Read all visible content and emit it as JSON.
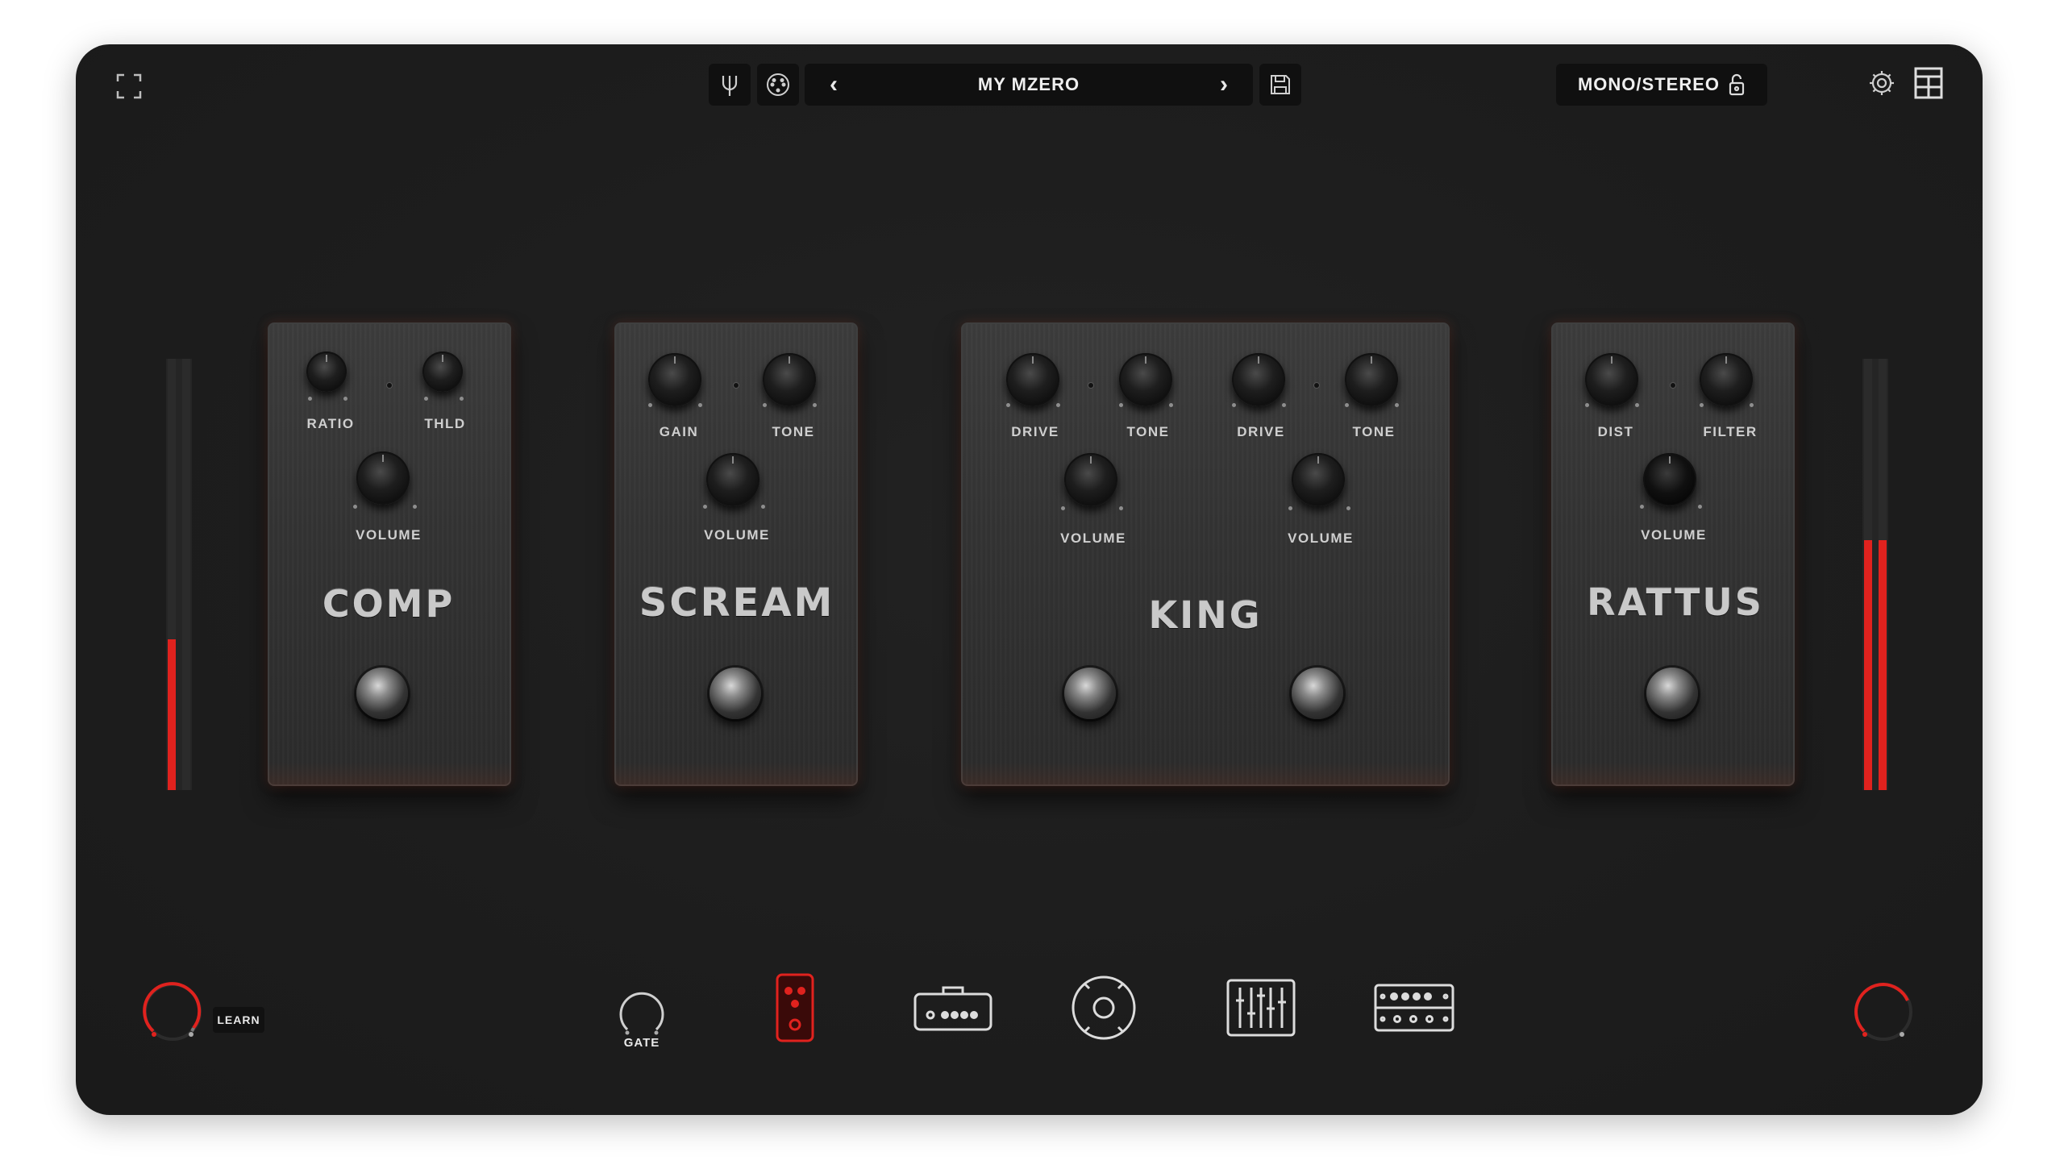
{
  "topbar": {
    "fullscreen_icon": "expand-corners-icon",
    "tuner_icon": "tuner-fork-icon",
    "midi_icon": "midi-port-icon",
    "preset_prev": "‹",
    "preset_name": "MY MZERO",
    "preset_next": "›",
    "save_icon": "floppy-disk-icon",
    "mode_label": "MONO/STEREO",
    "lock_icon": "padlock-icon",
    "settings_icon": "gear-icon",
    "logo_icon": "brand-logo-icon"
  },
  "meters": {
    "input_level": 0.35,
    "output_level": 0.58,
    "color": "#e0221e"
  },
  "pedals": [
    {
      "name": "COMP",
      "knobs": [
        "RATIO",
        "THLD",
        "VOLUME"
      ]
    },
    {
      "name": "SCREAM",
      "knobs": [
        "GAIN",
        "TONE",
        "VOLUME"
      ]
    },
    {
      "name": "KING",
      "knobs": [
        "DRIVE",
        "TONE",
        "DRIVE",
        "TONE",
        "VOLUME",
        "VOLUME"
      ]
    },
    {
      "name": "RATTUS",
      "knobs": [
        "DIST",
        "FILTER",
        "VOLUME"
      ]
    }
  ],
  "bottom": {
    "input_knob_icon": "input-gain-knob",
    "learn_label": "LEARN",
    "gate_label": "GATE",
    "output_knob_icon": "output-gain-knob",
    "nav": [
      "pedalboard-icon",
      "amplifier-icon",
      "cabinet-speaker-icon",
      "mixer-faders-icon",
      "rack-effects-icon"
    ],
    "active_nav": "pedalboard-icon",
    "accent_color": "#e0221e"
  }
}
